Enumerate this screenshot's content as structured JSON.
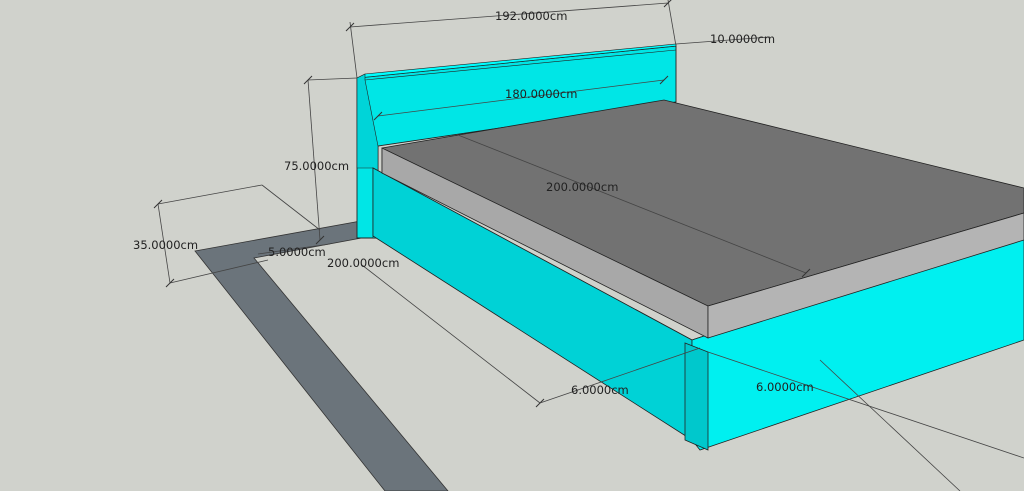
{
  "dimensions": {
    "headboard_width": "192.0000cm",
    "headboard_thickness": "10.0000cm",
    "inner_width": "180.0000cm",
    "headboard_height": "75.0000cm",
    "mattress_length": "200.0000cm",
    "base_height": "35.0000cm",
    "frame_offset": "5.0000cm",
    "base_length": "200.0000cm",
    "leg_depth": "6.0000cm",
    "leg_width": "6.0000cm"
  },
  "colors": {
    "background": "#d0d2cc",
    "cyan_front": "#00e6e6",
    "cyan_top": "#00ffff",
    "cyan_side": "#00c4c8",
    "mattress_top": "#727272",
    "mattress_side": "#a8a8a8",
    "floor_frame": "#6b747b"
  }
}
